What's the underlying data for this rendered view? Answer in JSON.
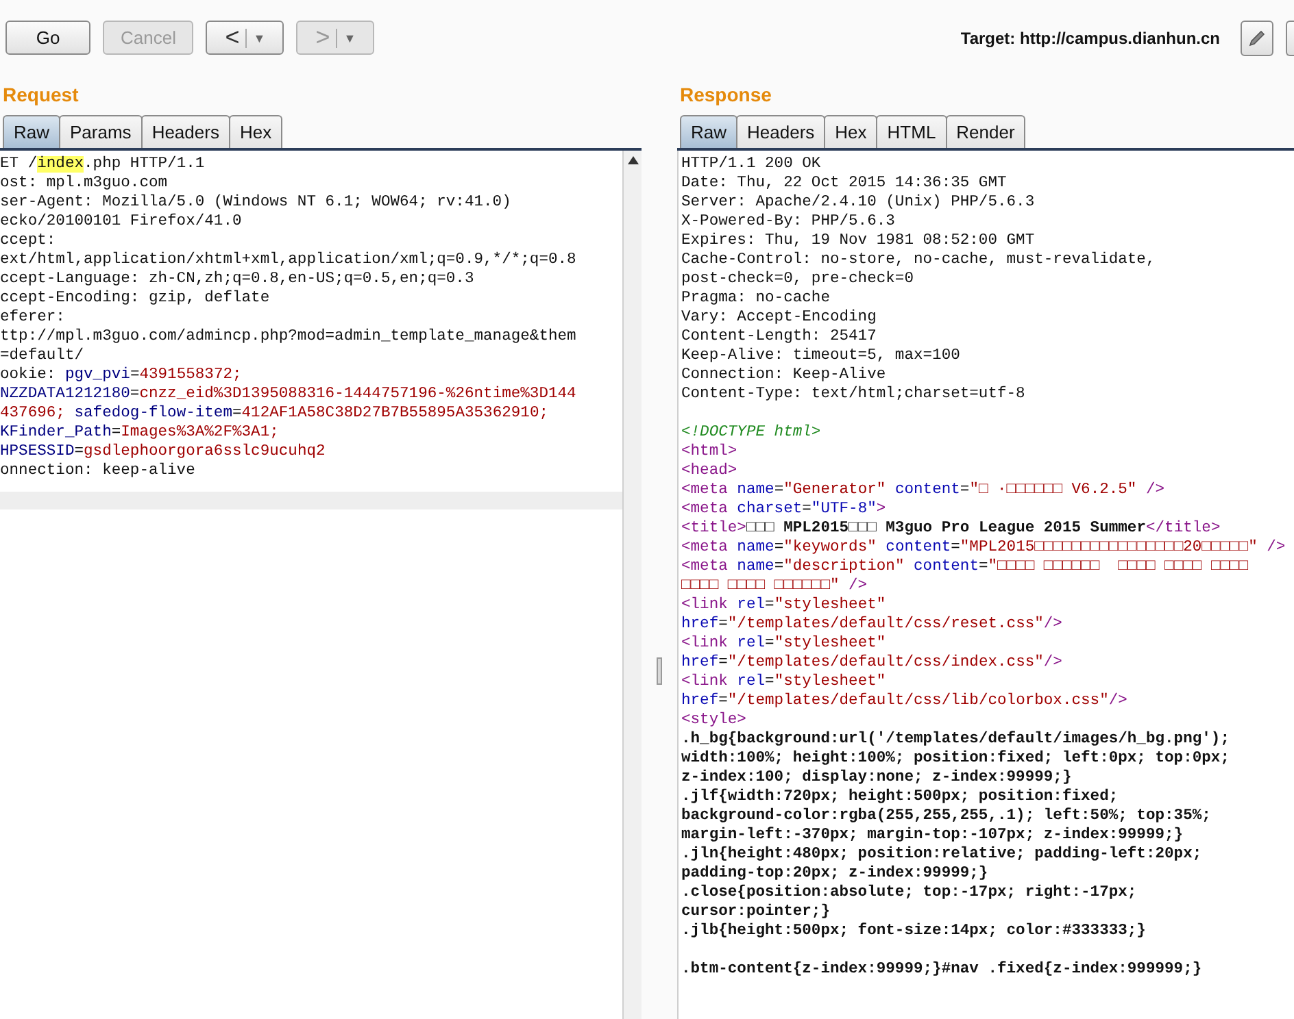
{
  "toolbar": {
    "buttons": [
      {
        "label": "Go",
        "disabled": false
      },
      {
        "label": "Cancel",
        "disabled": true
      }
    ],
    "nav": [
      {
        "arrow": "<",
        "caret": "▼",
        "disabled": false
      },
      {
        "arrow": ">",
        "caret": "▼",
        "disabled": true
      }
    ],
    "target": "Target: http://campus.dianhun.cn"
  },
  "request": {
    "title": "Request",
    "tabs": [
      {
        "label": "Raw",
        "selected": true
      },
      {
        "label": "Params",
        "selected": false
      },
      {
        "label": "Headers",
        "selected": false
      },
      {
        "label": "Hex",
        "selected": false
      }
    ],
    "lines": [
      {
        "parts": [
          {
            "text": "ET /",
            "kind": "plain"
          },
          {
            "text": "index",
            "kind": "match"
          },
          {
            "text": ".php HTTP/1.1",
            "kind": "plain"
          }
        ]
      },
      {
        "parts": [
          {
            "text": "ost: mpl.m3guo.com",
            "kind": "plain"
          }
        ]
      },
      {
        "parts": [
          {
            "text": "ser-Agent: Mozilla/5.0 (Windows NT 6.1; WOW64; rv:41.0)",
            "kind": "plain"
          }
        ]
      },
      {
        "parts": [
          {
            "text": "ecko/20100101 Firefox/41.0",
            "kind": "plain"
          }
        ]
      },
      {
        "parts": [
          {
            "text": "ccept:",
            "kind": "plain"
          }
        ]
      },
      {
        "parts": [
          {
            "text": "ext/html,application/xhtml+xml,application/xml;q=0.9,*/*;q=0.8",
            "kind": "plain"
          }
        ]
      },
      {
        "parts": [
          {
            "text": "ccept-Language: zh-CN,zh;q=0.8,en-US;q=0.5,en;q=0.3",
            "kind": "plain"
          }
        ]
      },
      {
        "parts": [
          {
            "text": "ccept-Encoding: gzip, deflate",
            "kind": "plain"
          }
        ]
      },
      {
        "parts": [
          {
            "text": "eferer:",
            "kind": "plain"
          }
        ]
      },
      {
        "parts": [
          {
            "text": "ttp://mpl.m3guo.com/admincp.php?mod=admin_template_manage&them",
            "kind": "plain"
          }
        ]
      },
      {
        "parts": [
          {
            "text": "=default/",
            "kind": "plain"
          }
        ]
      },
      {
        "parts": [
          {
            "text": "ookie: ",
            "kind": "plain"
          },
          {
            "text": "pgv_pvi",
            "kind": "name"
          },
          {
            "text": "=",
            "kind": "plain"
          },
          {
            "text": "4391558372;",
            "kind": "value"
          }
        ]
      },
      {
        "parts": [
          {
            "text": "NZZDATA1212180",
            "kind": "name"
          },
          {
            "text": "=",
            "kind": "plain"
          },
          {
            "text": "cnzz_eid%3D1395088316-1444757196-%26ntime%3D144",
            "kind": "value"
          }
        ]
      },
      {
        "parts": [
          {
            "text": "437696;",
            "kind": "value"
          },
          {
            "text": " safedog-flow-item",
            "kind": "name"
          },
          {
            "text": "=",
            "kind": "plain"
          },
          {
            "text": "412AF1A58C38D27B7B55895A35362910;",
            "kind": "value"
          }
        ]
      },
      {
        "parts": [
          {
            "text": "KFinder_Path",
            "kind": "name"
          },
          {
            "text": "=",
            "kind": "plain"
          },
          {
            "text": "Images%3A%2F%3A1;",
            "kind": "value"
          }
        ]
      },
      {
        "parts": [
          {
            "text": "HPSESSID",
            "kind": "name"
          },
          {
            "text": "=",
            "kind": "plain"
          },
          {
            "text": "gsdlephoorgora6sslc9ucuhq2",
            "kind": "value"
          }
        ]
      },
      {
        "parts": [
          {
            "text": "onnection: keep-alive",
            "kind": "plain"
          }
        ]
      }
    ]
  },
  "response": {
    "title": "Response",
    "tabs": [
      {
        "label": "Raw",
        "selected": true
      },
      {
        "label": "Headers",
        "selected": false
      },
      {
        "label": "Hex",
        "selected": false
      },
      {
        "label": "HTML",
        "selected": false
      },
      {
        "label": "Render",
        "selected": false
      }
    ],
    "sections": [
      {
        "lines": [
          {
            "parts": [
              {
                "text": "HTTP/1.1 200 OK",
                "kind": "plain"
              }
            ]
          },
          {
            "parts": [
              {
                "text": "Date: Thu, 22 Oct 2015 14:36:35 GMT",
                "kind": "plain"
              }
            ]
          },
          {
            "parts": [
              {
                "text": "Server: Apache/2.4.10 (Unix) PHP/5.6.3",
                "kind": "plain"
              }
            ]
          },
          {
            "parts": [
              {
                "text": "X-Powered-By: PHP/5.6.3",
                "kind": "plain"
              }
            ]
          },
          {
            "parts": [
              {
                "text": "Expires: Thu, 19 Nov 1981 08:52:00 GMT",
                "kind": "plain"
              }
            ]
          },
          {
            "parts": [
              {
                "text": "Cache-Control: no-store, no-cache, must-revalidate,",
                "kind": "plain"
              }
            ]
          },
          {
            "parts": [
              {
                "text": "post-check=0, pre-check=0",
                "kind": "plain"
              }
            ]
          },
          {
            "parts": [
              {
                "text": "Pragma: no-cache",
                "kind": "plain"
              }
            ]
          },
          {
            "parts": [
              {
                "text": "Vary: Accept-Encoding",
                "kind": "plain"
              }
            ]
          },
          {
            "parts": [
              {
                "text": "Content-Length: 25417",
                "kind": "plain"
              }
            ]
          },
          {
            "parts": [
              {
                "text": "Keep-Alive: timeout=5, max=100",
                "kind": "plain"
              }
            ]
          },
          {
            "parts": [
              {
                "text": "Connection: Keep-Alive",
                "kind": "plain"
              }
            ]
          },
          {
            "parts": [
              {
                "text": "Content-Type: text/html;charset=utf-8",
                "kind": "plain"
              }
            ]
          }
        ]
      },
      {
        "lines": [
          {
            "parts": [
              {
                "text": "<!DOCTYPE html>",
                "kind": "doctype"
              }
            ]
          },
          {
            "parts": [
              {
                "text": "<html>",
                "kind": "tag"
              }
            ]
          },
          {
            "parts": [
              {
                "text": "<head>",
                "kind": "tag"
              }
            ]
          },
          {
            "parts": [
              {
                "text": "<meta",
                "kind": "tag"
              },
              {
                "text": " name",
                "kind": "attr"
              },
              {
                "text": "=",
                "kind": "plain"
              },
              {
                "text": "\"Generator\"",
                "kind": "string"
              },
              {
                "text": " content",
                "kind": "attr"
              },
              {
                "text": "=",
                "kind": "plain"
              },
              {
                "text": "\"□ ·□□□□□□ V6.2.5\"",
                "kind": "string"
              },
              {
                "text": " />",
                "kind": "tag"
              }
            ]
          },
          {
            "parts": [
              {
                "text": "<meta",
                "kind": "tag"
              },
              {
                "text": " charset",
                "kind": "attr"
              },
              {
                "text": "=",
                "kind": "plain"
              },
              {
                "text": "\"UTF-8\"",
                "kind": "attr"
              },
              {
                "text": ">",
                "kind": "tag"
              }
            ]
          },
          {
            "parts": [
              {
                "text": "<title>",
                "kind": "tag"
              },
              {
                "text": "□□□ MPL2015□□□ M3guo Pro League 2015 Summer",
                "kind": "bold"
              },
              {
                "text": "</title>",
                "kind": "tag"
              }
            ]
          },
          {
            "parts": [
              {
                "text": "<meta",
                "kind": "tag"
              },
              {
                "text": " name",
                "kind": "attr"
              },
              {
                "text": "=",
                "kind": "plain"
              },
              {
                "text": "\"keywords\"",
                "kind": "string"
              },
              {
                "text": " content",
                "kind": "attr"
              },
              {
                "text": "=",
                "kind": "plain"
              },
              {
                "text": "\"MPL2015□□□□□□□□□□□□□□□□20□□□□□\"",
                "kind": "string"
              },
              {
                "text": " />",
                "kind": "tag"
              }
            ]
          },
          {
            "parts": [
              {
                "text": "<meta",
                "kind": "tag"
              },
              {
                "text": " name",
                "kind": "attr"
              },
              {
                "text": "=",
                "kind": "plain"
              },
              {
                "text": "\"description\"",
                "kind": "string"
              },
              {
                "text": " content",
                "kind": "attr"
              },
              {
                "text": "=",
                "kind": "plain"
              },
              {
                "text": "\"□□□□ □□□□□□  □□□□ □□□□ □□□□",
                "kind": "string"
              }
            ]
          },
          {
            "parts": [
              {
                "text": "□□□□ □□□□ □□□□□□\"",
                "kind": "string"
              },
              {
                "text": " />",
                "kind": "tag"
              }
            ]
          },
          {
            "parts": [
              {
                "text": "<link",
                "kind": "tag"
              },
              {
                "text": " rel",
                "kind": "attr"
              },
              {
                "text": "=",
                "kind": "plain"
              },
              {
                "text": "\"stylesheet\"",
                "kind": "string"
              }
            ]
          },
          {
            "parts": [
              {
                "text": "href",
                "kind": "attr"
              },
              {
                "text": "=",
                "kind": "plain"
              },
              {
                "text": "\"/templates/default/css/reset.css\"",
                "kind": "string"
              },
              {
                "text": "/>",
                "kind": "tag"
              }
            ]
          },
          {
            "parts": [
              {
                "text": "<link",
                "kind": "tag"
              },
              {
                "text": " rel",
                "kind": "attr"
              },
              {
                "text": "=",
                "kind": "plain"
              },
              {
                "text": "\"stylesheet\"",
                "kind": "string"
              }
            ]
          },
          {
            "parts": [
              {
                "text": "href",
                "kind": "attr"
              },
              {
                "text": "=",
                "kind": "plain"
              },
              {
                "text": "\"/templates/default/css/index.css\"",
                "kind": "string"
              },
              {
                "text": "/>",
                "kind": "tag"
              }
            ]
          },
          {
            "parts": [
              {
                "text": "<link",
                "kind": "tag"
              },
              {
                "text": " rel",
                "kind": "attr"
              },
              {
                "text": "=",
                "kind": "plain"
              },
              {
                "text": "\"stylesheet\"",
                "kind": "string"
              }
            ]
          },
          {
            "parts": [
              {
                "text": "href",
                "kind": "attr"
              },
              {
                "text": "=",
                "kind": "plain"
              },
              {
                "text": "\"/templates/default/css/lib/colorbox.css\"",
                "kind": "string"
              },
              {
                "text": "/>",
                "kind": "tag"
              }
            ]
          },
          {
            "parts": [
              {
                "text": "<style>",
                "kind": "tag"
              }
            ]
          },
          {
            "parts": [
              {
                "text": ".h_bg{background:url('/templates/default/images/h_bg.png');",
                "kind": "bold"
              }
            ]
          },
          {
            "parts": [
              {
                "text": "width:100%; height:100%; position:fixed; left:0px; top:0px;",
                "kind": "bold"
              }
            ]
          },
          {
            "parts": [
              {
                "text": "z-index:100; display:none; z-index:99999;}",
                "kind": "bold"
              }
            ]
          },
          {
            "parts": [
              {
                "text": ".jlf{width:720px; height:500px; position:fixed;",
                "kind": "bold"
              }
            ]
          },
          {
            "parts": [
              {
                "text": "background-color:rgba(255,255,255,.1); left:50%; top:35%;",
                "kind": "bold"
              }
            ]
          },
          {
            "parts": [
              {
                "text": "margin-left:-370px; margin-top:-107px; z-index:99999;}",
                "kind": "bold"
              }
            ]
          },
          {
            "parts": [
              {
                "text": ".jln{height:480px; position:relative; padding-left:20px;",
                "kind": "bold"
              }
            ]
          },
          {
            "parts": [
              {
                "text": "padding-top:20px; z-index:99999;}",
                "kind": "bold"
              }
            ]
          },
          {
            "parts": [
              {
                "text": ".close{position:absolute; top:-17px; right:-17px;",
                "kind": "bold"
              }
            ]
          },
          {
            "parts": [
              {
                "text": "cursor:pointer;}",
                "kind": "bold"
              }
            ]
          },
          {
            "parts": [
              {
                "text": ".jlb{height:500px; font-size:14px; color:#333333;}",
                "kind": "bold"
              }
            ]
          }
        ]
      },
      {
        "lines": [
          {
            "parts": [
              {
                "text": ".btm-content{z-index:99999;}#nav .fixed{z-index:999999;}",
                "kind": "bold"
              }
            ]
          }
        ]
      }
    ]
  }
}
